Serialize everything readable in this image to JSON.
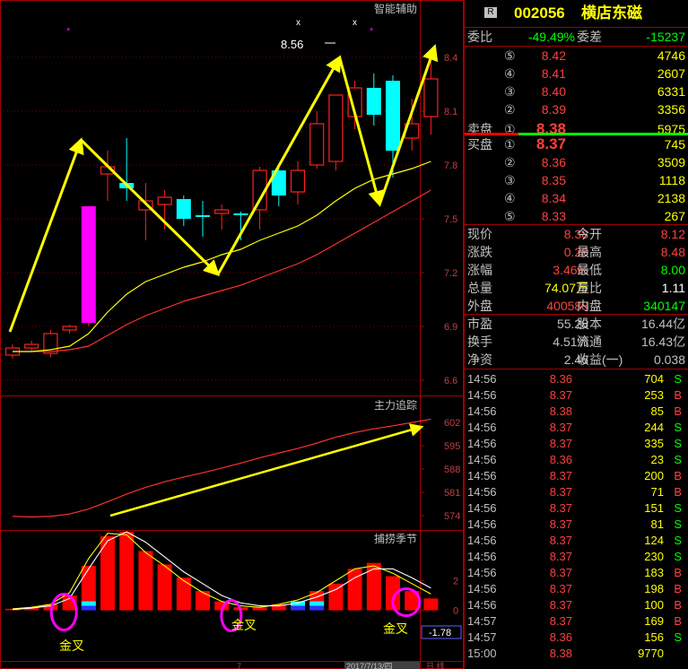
{
  "chart_data": [
    {
      "panel": "main",
      "type": "candlestick",
      "title": "智能辅助",
      "y_ticks": [
        "8.4",
        "8.1",
        "7.8",
        "7.5",
        "7.2",
        "6.9",
        "6.6"
      ],
      "ylim": [
        6.53,
        8.63
      ],
      "candles": [
        {
          "o": 6.74,
          "c": 6.78,
          "h": 6.8,
          "l": 6.72
        },
        {
          "o": 6.78,
          "c": 6.8,
          "h": 6.82,
          "l": 6.76
        },
        {
          "o": 6.75,
          "c": 6.86,
          "h": 6.88,
          "l": 6.73
        },
        {
          "o": 6.88,
          "c": 6.9,
          "h": 6.91,
          "l": 6.86
        },
        {
          "o": 6.92,
          "c": 7.57,
          "h": 7.57,
          "l": 6.9
        },
        {
          "o": 7.75,
          "c": 7.79,
          "h": 7.88,
          "l": 7.6
        },
        {
          "o": 7.7,
          "c": 7.67,
          "h": 7.95,
          "l": 7.6
        },
        {
          "o": 7.55,
          "c": 7.6,
          "h": 7.7,
          "l": 7.38
        },
        {
          "o": 7.58,
          "c": 7.62,
          "h": 7.66,
          "l": 7.44
        },
        {
          "o": 7.61,
          "c": 7.5,
          "h": 7.63,
          "l": 7.46
        },
        {
          "o": 7.52,
          "c": 7.51,
          "h": 7.6,
          "l": 7.4
        },
        {
          "o": 7.53,
          "c": 7.55,
          "h": 7.58,
          "l": 7.44
        },
        {
          "o": 7.53,
          "c": 7.52,
          "h": 7.54,
          "l": 7.38
        },
        {
          "o": 7.55,
          "c": 7.77,
          "h": 7.79,
          "l": 7.44
        },
        {
          "o": 7.77,
          "c": 7.63,
          "h": 7.8,
          "l": 7.57
        },
        {
          "o": 7.65,
          "c": 7.77,
          "h": 7.82,
          "l": 7.58
        },
        {
          "o": 7.8,
          "c": 8.03,
          "h": 8.1,
          "l": 7.78
        },
        {
          "o": 7.82,
          "c": 8.19,
          "h": 8.19,
          "l": 7.77
        },
        {
          "o": 8.07,
          "c": 8.23,
          "h": 8.27,
          "l": 8.0
        },
        {
          "o": 8.23,
          "c": 8.08,
          "h": 8.31,
          "l": 8.02
        },
        {
          "o": 8.27,
          "c": 7.88,
          "h": 8.3,
          "l": 7.73
        },
        {
          "o": 7.95,
          "c": 8.03,
          "h": 8.17,
          "l": 7.88
        },
        {
          "o": 8.07,
          "c": 8.28,
          "h": 8.42,
          "l": 7.97
        }
      ],
      "ma_yellow": [
        6.76,
        6.76,
        6.77,
        6.79,
        6.86,
        6.98,
        7.08,
        7.15,
        7.19,
        7.23,
        7.26,
        7.3,
        7.33,
        7.38,
        7.42,
        7.46,
        7.52,
        7.6,
        7.67,
        7.72,
        7.75,
        7.78,
        7.82
      ],
      "ma_red": [
        6.76,
        6.76,
        6.76,
        6.77,
        6.79,
        6.85,
        6.91,
        6.96,
        7.0,
        7.04,
        7.07,
        7.1,
        7.13,
        7.17,
        7.21,
        7.25,
        7.3,
        7.36,
        7.42,
        7.48,
        7.54,
        7.6,
        7.66
      ],
      "annotation_price": "8.56",
      "colors": {
        "up": "#ff2020",
        "down": "#00ffff",
        "spike": "#ff00ff",
        "ma1": "#ffff00",
        "ma2": "#ff3030",
        "arrow": "#ffff00",
        "mark": "#ff00ff"
      }
    },
    {
      "panel": "middle",
      "type": "line",
      "title": "主力追踪",
      "y_ticks": [
        "602",
        "595",
        "588",
        "581",
        "574"
      ],
      "ylim": [
        570.5,
        605.0
      ],
      "values": [
        573.8,
        573.6,
        573.8,
        574.5,
        576.0,
        578.2,
        580.5,
        582.5,
        584.2,
        585.6,
        586.9,
        588.3,
        589.8,
        591.4,
        592.8,
        594.2,
        595.8,
        597.6,
        599.0,
        600.1,
        601.0,
        602.0,
        603.0
      ]
    },
    {
      "panel": "bottom",
      "type": "bar",
      "title": "捕捞季节",
      "y_ticks": [
        "2",
        "0"
      ],
      "ylim": [
        -3.3,
        5.0
      ],
      "values": [
        0.1,
        0.2,
        0.4,
        1.0,
        3.0,
        5.0,
        5.3,
        4.0,
        3.1,
        2.2,
        1.3,
        0.6,
        0.2,
        0.2,
        0.4,
        0.6,
        1.3,
        1.8,
        2.8,
        3.2,
        2.3,
        1.3,
        0.8
      ],
      "lines": {
        "yellow": [
          0.1,
          0.2,
          0.4,
          1.2,
          3.5,
          5.2,
          5.1,
          3.9,
          3.0,
          2.0,
          1.2,
          0.6,
          0.3,
          0.2,
          0.4,
          0.7,
          1.2,
          2.0,
          2.8,
          3.0,
          2.5,
          1.8,
          1.1
        ],
        "white": [
          0.05,
          0.15,
          0.3,
          0.8,
          2.8,
          4.7,
          5.3,
          4.6,
          3.6,
          2.6,
          1.8,
          1.0,
          0.5,
          0.3,
          0.3,
          0.5,
          0.9,
          1.4,
          2.2,
          2.8,
          2.8,
          2.2,
          1.5
        ]
      },
      "value_label": "-1.78",
      "golden_cross_labels": [
        "金叉",
        "金叉",
        "金叉"
      ]
    }
  ],
  "bottom_bar": {
    "date": "2017/7/13/四",
    "mark": "7",
    "tail": "日 线"
  },
  "quote": {
    "header": {
      "badge": "R",
      "code": "002056",
      "name": "横店东磁"
    },
    "weibi": {
      "label": "委比",
      "value": "-49.49%",
      "label2": "委差",
      "value2": "-15237"
    },
    "sell": [
      {
        "no": "⑤",
        "price": "8.42",
        "vol": "4746"
      },
      {
        "no": "④",
        "price": "8.41",
        "vol": "2607"
      },
      {
        "no": "③",
        "price": "8.40",
        "vol": "6331"
      },
      {
        "no": "②",
        "price": "8.39",
        "vol": "3356"
      },
      {
        "no": "①",
        "price": "8.38",
        "vol": "5975"
      }
    ],
    "sell_label": "卖盘",
    "buy_label": "买盘",
    "buy": [
      {
        "no": "①",
        "price": "8.37",
        "vol": "745"
      },
      {
        "no": "②",
        "price": "8.36",
        "vol": "3509"
      },
      {
        "no": "③",
        "price": "8.35",
        "vol": "1118"
      },
      {
        "no": "④",
        "price": "8.34",
        "vol": "2138"
      },
      {
        "no": "⑤",
        "price": "8.33",
        "vol": "267"
      }
    ],
    "stats": [
      {
        "l1": "现价",
        "v1": "8.38",
        "l2": "今开",
        "v2": "8.12",
        "c1": "#ff4040",
        "c2": "#ff4040"
      },
      {
        "l1": "涨跌",
        "v1": "0.28",
        "l2": "最高",
        "v2": "8.48",
        "c1": "#ff4040",
        "c2": "#ff4040"
      },
      {
        "l1": "涨幅",
        "v1": "3.46%",
        "l2": "最低",
        "v2": "8.00",
        "c1": "#ff4040",
        "c2": "#00ff00"
      },
      {
        "l1": "总量",
        "v1": "74.07万",
        "l2": "量比",
        "v2": "1.11",
        "c1": "#ffff00",
        "c2": "#ffffff"
      },
      {
        "l1": "外盘",
        "v1": "400588",
        "l2": "内盘",
        "v2": "340147",
        "c1": "#ff4040",
        "c2": "#00ff00"
      }
    ],
    "stats2": [
      {
        "l1": "市盈",
        "v1": "55.28",
        "l2": "股本",
        "v2": "16.44亿"
      },
      {
        "l1": "换手",
        "v1": "4.51%",
        "l2": "流通",
        "v2": "16.43亿"
      },
      {
        "l1": "净资",
        "v1": "2.46",
        "l2": "收益(一)",
        "v2": "0.038"
      }
    ],
    "ticks": [
      {
        "t": "14:56",
        "p": "8.36",
        "v": "704",
        "d": "S"
      },
      {
        "t": "14:56",
        "p": "8.37",
        "v": "253",
        "d": "B"
      },
      {
        "t": "14:56",
        "p": "8.38",
        "v": "85",
        "d": "B"
      },
      {
        "t": "14:56",
        "p": "8.37",
        "v": "244",
        "d": "S"
      },
      {
        "t": "14:56",
        "p": "8.37",
        "v": "335",
        "d": "S"
      },
      {
        "t": "14:56",
        "p": "8.36",
        "v": "23",
        "d": "S"
      },
      {
        "t": "14:56",
        "p": "8.37",
        "v": "200",
        "d": "B"
      },
      {
        "t": "14:56",
        "p": "8.37",
        "v": "71",
        "d": "B"
      },
      {
        "t": "14:56",
        "p": "8.37",
        "v": "151",
        "d": "S"
      },
      {
        "t": "14:56",
        "p": "8.37",
        "v": "81",
        "d": "S"
      },
      {
        "t": "14:56",
        "p": "8.37",
        "v": "124",
        "d": "S"
      },
      {
        "t": "14:56",
        "p": "8.37",
        "v": "230",
        "d": "S"
      },
      {
        "t": "14:56",
        "p": "8.37",
        "v": "183",
        "d": "B"
      },
      {
        "t": "14:56",
        "p": "8.37",
        "v": "198",
        "d": "B"
      },
      {
        "t": "14:56",
        "p": "8.37",
        "v": "100",
        "d": "B"
      },
      {
        "t": "14:57",
        "p": "8.37",
        "v": "169",
        "d": "B"
      },
      {
        "t": "14:57",
        "p": "8.36",
        "v": "156",
        "d": "S"
      },
      {
        "t": "15:00",
        "p": "8.38",
        "v": "9770",
        "d": ""
      }
    ]
  }
}
